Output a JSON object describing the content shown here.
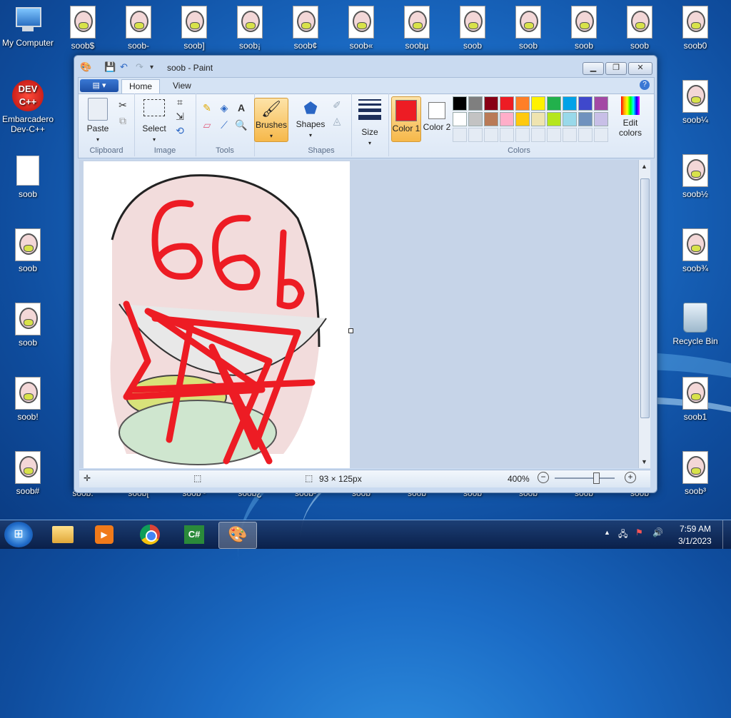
{
  "desktop": {
    "left_icons": [
      {
        "label": "My Computer"
      },
      {
        "label": "Embarcadero Dev-C++"
      },
      {
        "label": "soob"
      },
      {
        "label": "soob"
      },
      {
        "label": "soob"
      },
      {
        "label": "soob!"
      },
      {
        "label": "soob#"
      }
    ],
    "top_icons": [
      "soob$",
      "soob-",
      "soob]",
      "soob¡",
      "soob¢",
      "soob«",
      "soobµ",
      "soob",
      "soob",
      "soob",
      "soob",
      "soob0"
    ],
    "right_icons": [
      "soob¼",
      "soob½",
      "soob¾",
      "Recycle Bin",
      "soob1",
      "soob³"
    ],
    "bottom_partial": [
      "soob.",
      "soob[",
      "soob~",
      "soob¿",
      "soob²",
      "soob",
      "soob",
      "soob",
      "soob",
      "soob",
      "soob"
    ],
    "dev_logo_text": "DEV C++"
  },
  "paint": {
    "title": "soob - Paint",
    "tabs": [
      "Home",
      "View"
    ],
    "app_menu_icon": "paint-menu-icon",
    "help_icon": "help-icon",
    "groups": {
      "clipboard": {
        "label": "Clipboard",
        "paste": "Paste"
      },
      "image": {
        "label": "Image",
        "select": "Select"
      },
      "tools": {
        "label": "Tools"
      },
      "brushes": {
        "label": "Brushes"
      },
      "shapes": {
        "label": "Shapes",
        "button": "Shapes"
      },
      "size": {
        "label": "Size"
      },
      "colors": {
        "label": "Colors",
        "color1": "Color 1",
        "color2": "Color 2",
        "edit": "Edit colors"
      }
    },
    "palette_row1": [
      "#000000",
      "#7f7f7f",
      "#880015",
      "#ed1c24",
      "#ff7f27",
      "#fff200",
      "#22b14c",
      "#00a2e8",
      "#3f48cc",
      "#a349a4"
    ],
    "palette_row2": [
      "#ffffff",
      "#c3c3c3",
      "#b97a57",
      "#ffaec9",
      "#ffc90e",
      "#efe4b0",
      "#b5e61d",
      "#99d9ea",
      "#7092be",
      "#c8bfe7"
    ],
    "color1_value": "#ed1c24",
    "color2_value": "#ffffff",
    "status": {
      "image_size": "93 × 125px",
      "zoom": "400%"
    }
  },
  "taskbar": {
    "time": "7:59 AM",
    "date": "3/1/2023"
  }
}
